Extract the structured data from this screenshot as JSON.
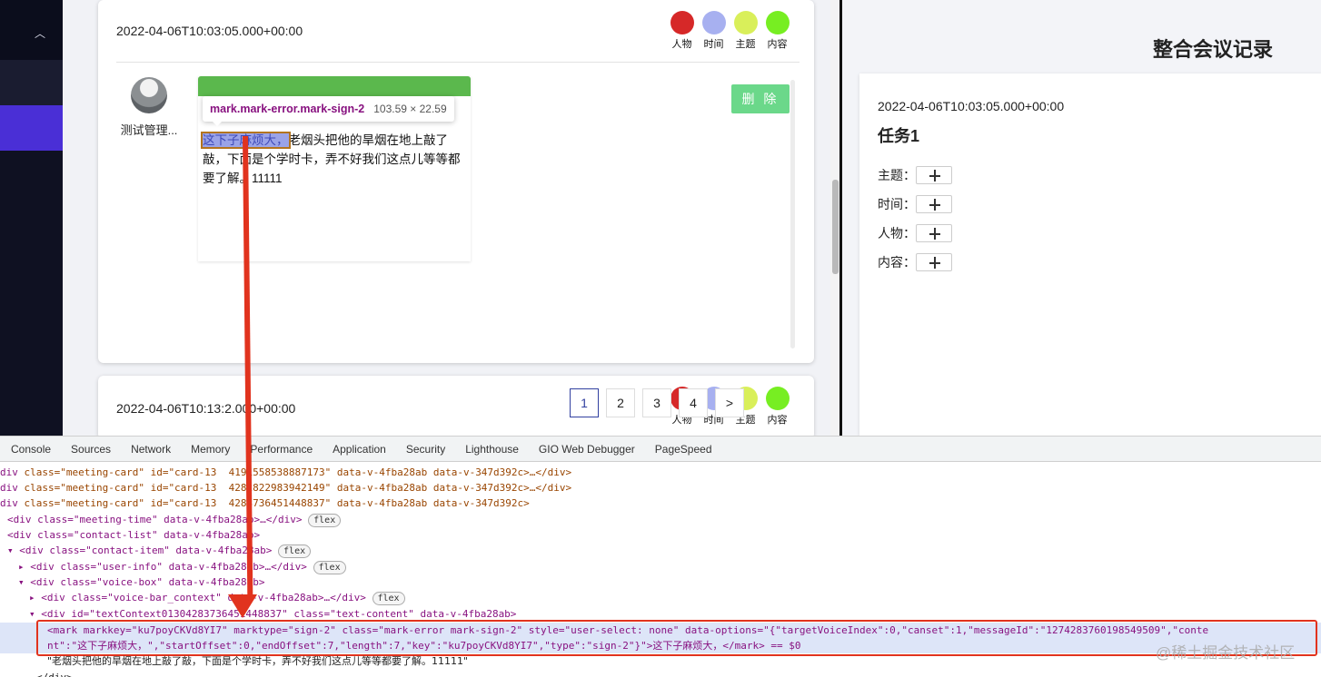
{
  "colors": {
    "person": "#d62828",
    "time": "#a7b0f0",
    "topic": "#d9ef5a",
    "content": "#77ee22",
    "voice_bar": "#5bb84d",
    "delete_button": "#6bd88a",
    "annotation_arrow": "#e1331e"
  },
  "meeting_cards": [
    {
      "time": "2022-04-06T10:03:05.000+00:00",
      "tags": [
        {
          "label": "人物",
          "color_key": "person"
        },
        {
          "label": "时间",
          "color_key": "time"
        },
        {
          "label": "主题",
          "color_key": "topic"
        },
        {
          "label": "内容",
          "color_key": "content"
        }
      ],
      "user_name": "测试管理...",
      "marked_text": "这下子麻烦大，",
      "rest_text": "老烟头把他的旱烟在地上敲了敲，下面是个学时卡，弄不好我们这点儿等等都要了解。11111",
      "delete_label": "删 除"
    },
    {
      "time_visible": "2022-04-06T10:13:",
      "time_tail": "2.000+00:00",
      "tags": [
        {
          "label": "人物"
        },
        {
          "label": "时间"
        },
        {
          "label": "主题"
        },
        {
          "label": "内容"
        }
      ]
    }
  ],
  "tooltip": {
    "selector": "mark.mark-error.mark-sign-2",
    "dimensions": "103.59 × 22.59"
  },
  "pagination": {
    "pages": [
      "1",
      "2",
      "3",
      "4"
    ],
    "active": "1",
    "next": ">"
  },
  "right_panel": {
    "title": "整合会议记录",
    "time": "2022-04-06T10:03:05.000+00:00",
    "task": "任务1",
    "fields": [
      "主题：",
      "时间：",
      "人物：",
      "内容："
    ]
  },
  "devtools": {
    "tabs": [
      "Console",
      "Sources",
      "Network",
      "Memory",
      "Performance",
      "Application",
      "Security",
      "Lighthouse",
      "GIO Web Debugger",
      "PageSpeed"
    ],
    "lines": [
      {
        "prefix": "div",
        "rest": " class=\"meeting-card\" id=\"card-13  4191558538887173\" data-v-4fba28ab data-v-347d392c>…</div>"
      },
      {
        "prefix": "div",
        "rest": " class=\"meeting-card\" id=\"card-13  4282822983942149\" data-v-4fba28ab data-v-347d392c>…</div>"
      },
      {
        "prefix": "div",
        "rest": " class=\"meeting-card\" id=\"card-13  4283736451448837\" data-v-4fba28ab data-v-347d392c>"
      },
      {
        "text": "<div class=\"meeting-time\" data-v-4fba28ab>…</div>",
        "badge": "flex"
      },
      {
        "text": "<div class=\"contact-list\" data-v-4fba28ab>"
      },
      {
        "text": "<div class=\"contact-item\" data-v-4fba28ab>",
        "badge": "flex"
      },
      {
        "text": "<div class=\"user-info\" data-v-4fba28ab>…</div>",
        "badge": "flex"
      },
      {
        "text": "<div class=\"voice-box\" data-v-4fba28ab>"
      },
      {
        "text": "<div class=\"voice-bar_context\" data-v-4fba28ab>…</div>",
        "badge": "flex"
      },
      {
        "text": "<div id=\"textContext01304283736451448837\" class=\"text-content\" data-v-4fba28ab>"
      }
    ],
    "selected_line_1": "<mark markkey=\"ku7poyCKVd8YI7\" marktype=\"sign-2\" class=\"mark-error mark-sign-2\" style=\"user-select: none\" data-options=\"{\"targetVoiceIndex\":0,\"canset\":1,\"messageId\":\"1274283760198549509\",\"conte",
    "selected_line_2": "nt\":\"这下子麻烦大，\",\"startOffset\":0,\"endOffset\":7,\"length\":7,\"key\":\"ku7poyCKVd8YI7\",\"type\":\"sign-2\"}\">这下子麻烦大，</mark> == $0",
    "text_node": "\"老烟头把他的旱烟在地上敲了敲，下面是个学时卡，弄不好我们这点儿等等都要了解。11111\"",
    "closing": "</div>"
  },
  "watermark": "@稀土掘金技术社区"
}
